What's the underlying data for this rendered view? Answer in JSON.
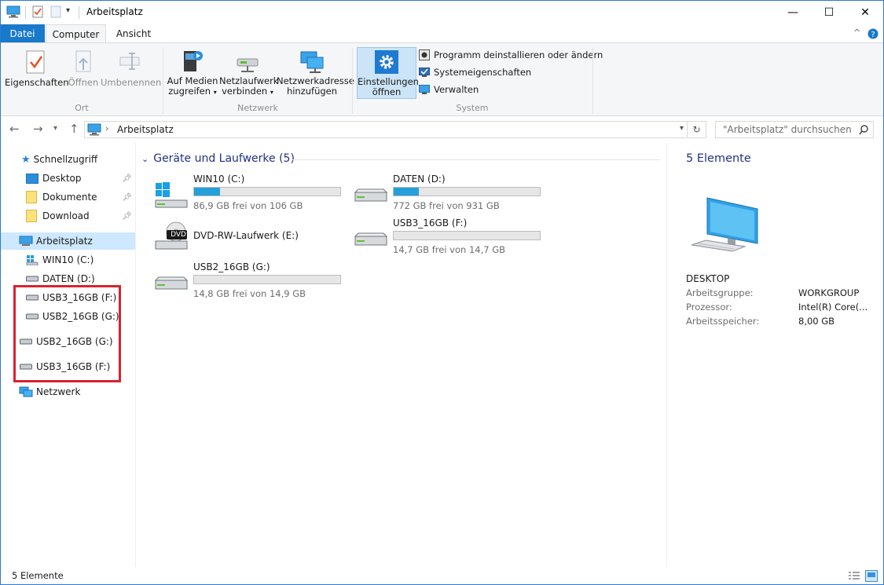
{
  "window": {
    "title": "Arbeitsplatz",
    "controls": {
      "minimize": "—",
      "maximize": "☐",
      "close": "✕"
    }
  },
  "ribbon_tabs": {
    "file": "Datei",
    "computer": "Computer",
    "view": "Ansicht",
    "help_caret": "^"
  },
  "ribbon": {
    "ort": {
      "label": "Ort",
      "properties": "Eigenschaften",
      "open": "Öffnen",
      "rename": "Umbenennen"
    },
    "netzwerk": {
      "label": "Netzwerk",
      "media_line1": "Auf Medien",
      "media_line2": "zugreifen",
      "map_line1": "Netzlaufwerk",
      "map_line2": "verbinden",
      "netaddr_line1": "Netzwerkadresse",
      "netaddr_line2": "hinzufügen"
    },
    "system": {
      "label": "System",
      "settings_line1": "Einstellungen",
      "settings_line2": "öffnen",
      "uninstall": "Programm deinstallieren oder ändern",
      "sysprops": "Systemeigenschaften",
      "manage": "Verwalten"
    }
  },
  "address": {
    "path": "Arbeitsplatz",
    "search_placeholder": "\"Arbeitsplatz\" durchsuchen"
  },
  "nav": {
    "quick_access": "Schnellzugriff",
    "quick_items": [
      {
        "label": "Desktop"
      },
      {
        "label": "Dokumente"
      },
      {
        "label": "Download"
      }
    ],
    "this_pc": "Arbeitsplatz",
    "drives": [
      {
        "label": "WIN10 (C:)"
      },
      {
        "label": "DATEN (D:)"
      },
      {
        "label": "USB3_16GB (F:)"
      },
      {
        "label": "USB2_16GB (G:)"
      }
    ],
    "extra_drives": [
      {
        "label": "USB2_16GB (G:)"
      },
      {
        "label": "USB3_16GB (F:)"
      }
    ],
    "network": "Netzwerk"
  },
  "content": {
    "group_title": "Geräte und Laufwerke (5)",
    "drives": [
      {
        "name": "WIN10 (C:)",
        "info": "86,9 GB frei von 106 GB",
        "used_fraction": 0.18,
        "icon": "windows-drive"
      },
      {
        "name": "DATEN (D:)",
        "info": "772 GB frei von 931 GB",
        "used_fraction": 0.17,
        "icon": "hard-drive"
      },
      {
        "name": "DVD-RW-Laufwerk (E:)",
        "info": "",
        "used_fraction": null,
        "icon": "dvd-drive"
      },
      {
        "name": "USB3_16GB (F:)",
        "info": "14,7 GB frei von 14,7 GB",
        "used_fraction": 0.0,
        "icon": "removable-drive"
      },
      {
        "name": "USB2_16GB (G:)",
        "info": "14,8 GB frei von 14,9 GB",
        "used_fraction": 0.0,
        "icon": "removable-drive"
      }
    ],
    "dvd_badge": "DVD"
  },
  "details": {
    "count": "5 Elemente",
    "computer_name": "DESKTOP",
    "rows": [
      {
        "key": "Arbeitsgruppe:",
        "value": "WORKGROUP"
      },
      {
        "key": "Prozessor:",
        "value": "Intel(R) Core(..."
      },
      {
        "key": "Arbeitsspeicher:",
        "value": "8,00 GB"
      }
    ]
  },
  "status": {
    "count": "5 Elemente"
  },
  "colors": {
    "accent": "#1979ca",
    "bar_fill": "#26a0da",
    "highlight": "#d9232f",
    "selected": "#cde8ff"
  }
}
